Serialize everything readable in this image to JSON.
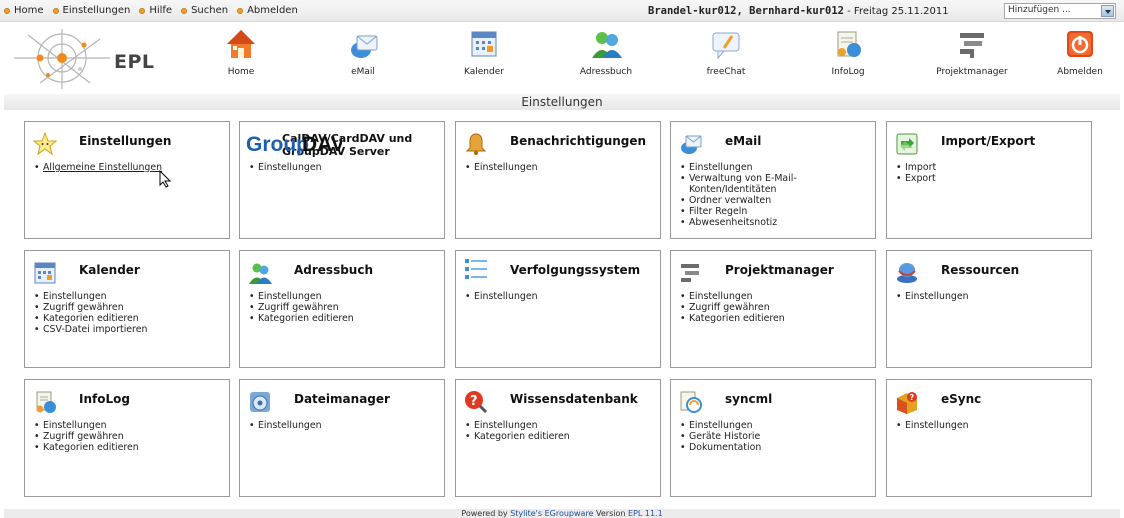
{
  "toplinks": [
    "Home",
    "Einstellungen",
    "Hilfe",
    "Suchen",
    "Abmelden"
  ],
  "user": {
    "name": "Brandel-kur012, Bernhard-kur012",
    "date": " - Freitag 25.11.2011"
  },
  "add_select": "Hinzufügen ...",
  "logo_text": "EPL",
  "apps": [
    {
      "label": "Home",
      "icon": "house-icon"
    },
    {
      "label": "eMail",
      "icon": "mail-icon"
    },
    {
      "label": "Kalender",
      "icon": "calendar-icon"
    },
    {
      "label": "Adressbuch",
      "icon": "addressbook-icon"
    },
    {
      "label": "freeChat",
      "icon": "chat-icon"
    },
    {
      "label": "InfoLog",
      "icon": "infolog-icon"
    },
    {
      "label": "Projektmanager",
      "icon": "projectmanager-icon"
    },
    {
      "label": "Abmelden",
      "icon": "logout-icon"
    }
  ],
  "section_title": "Einstellungen",
  "panels": [
    {
      "title": "Einstellungen",
      "icon": "star-icon",
      "items": [
        "Allgemeine Einstellungen"
      ]
    },
    {
      "title": "CalDAV/CardDAV und GroupDAV Server",
      "icon": "groupdav-logo",
      "items": [
        "Einstellungen"
      ]
    },
    {
      "title": "Benachrichtigungen",
      "icon": "bell-icon",
      "items": [
        "Einstellungen"
      ]
    },
    {
      "title": "eMail",
      "icon": "mail-icon",
      "items": [
        "Einstellungen",
        "Verwaltung von E-Mail-Konten/Identitäten",
        "Ordner verwalten",
        "Filter Regeln",
        "Abwesenheitsnotiz"
      ]
    },
    {
      "title": "Import/Export",
      "icon": "import-export-icon",
      "items": [
        "Import",
        "Export"
      ]
    },
    {
      "title": "Kalender",
      "icon": "calendar-icon",
      "items": [
        "Einstellungen",
        "Zugriff gewähren",
        "Kategorien editieren",
        "CSV-Datei importieren"
      ]
    },
    {
      "title": "Adressbuch",
      "icon": "addressbook-icon",
      "items": [
        "Einstellungen",
        "Zugriff gewähren",
        "Kategorien editieren"
      ]
    },
    {
      "title": "Verfolgungssystem",
      "icon": "list-icon",
      "items": [
        "Einstellungen"
      ]
    },
    {
      "title": "Projektmanager",
      "icon": "projectmanager-icon",
      "items": [
        "Einstellungen",
        "Zugriff gewähren",
        "Kategorien editieren"
      ]
    },
    {
      "title": "Ressourcen",
      "icon": "resources-icon",
      "items": [
        "Einstellungen"
      ]
    },
    {
      "title": "InfoLog",
      "icon": "infolog-icon",
      "items": [
        "Einstellungen",
        "Zugriff gewähren",
        "Kategorien editieren"
      ]
    },
    {
      "title": "Dateimanager",
      "icon": "filemanager-icon",
      "items": [
        "Einstellungen"
      ]
    },
    {
      "title": "Wissensdatenbank",
      "icon": "help-icon",
      "items": [
        "Einstellungen",
        "Kategorien editieren"
      ]
    },
    {
      "title": "syncml",
      "icon": "syncml-icon",
      "items": [
        "Einstellungen",
        "Geräte Historie",
        "Dokumentation"
      ]
    },
    {
      "title": "eSync",
      "icon": "esync-icon",
      "items": [
        "Einstellungen"
      ]
    }
  ],
  "footer": {
    "prefix": "Powered by ",
    "link": "Stylite's EGroupware",
    "middle": " Version ",
    "version": "EPL 11.1"
  }
}
